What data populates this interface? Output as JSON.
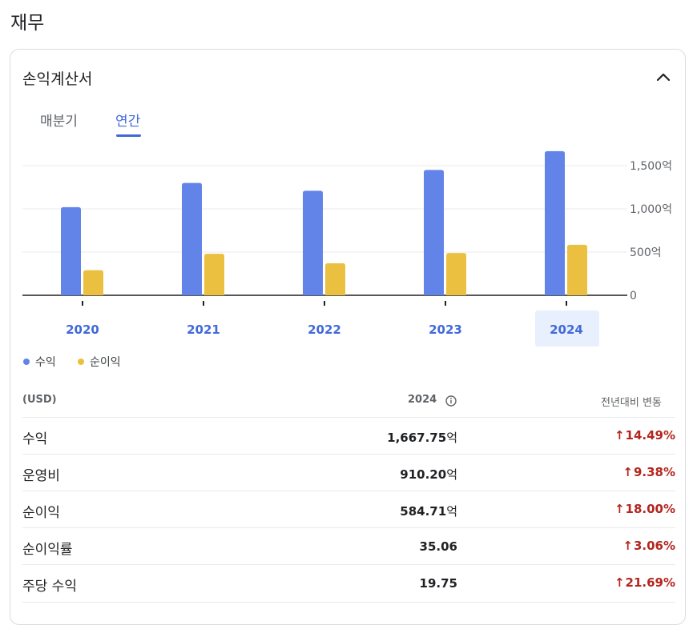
{
  "page_title": "재무",
  "card": {
    "title": "손익계산서",
    "tabs": [
      {
        "label": "매분기",
        "selected": false
      },
      {
        "label": "연간",
        "selected": true
      }
    ]
  },
  "colors": {
    "revenue": "#6284e8",
    "net_income": "#ebc040",
    "accent": "#4169d9",
    "up": "#b3261e"
  },
  "chart_data": {
    "type": "bar",
    "categories": [
      "2020",
      "2021",
      "2022",
      "2023",
      "2024"
    ],
    "selected_category": "2024",
    "series": [
      {
        "name": "수익",
        "values": [
          1020,
          1300,
          1210,
          1450,
          1667.75
        ]
      },
      {
        "name": "순이익",
        "values": [
          290,
          480,
          370,
          490,
          584.71
        ]
      }
    ],
    "ylim": [
      0,
      1500
    ],
    "yticks": [
      {
        "value": 0,
        "label": "0"
      },
      {
        "value": 500,
        "label": "500억"
      },
      {
        "value": 1000,
        "label": "1,000억"
      },
      {
        "value": 1500,
        "label": "1,500억"
      }
    ],
    "grid": true
  },
  "table": {
    "currency": "(USD)",
    "year": "2024",
    "change_header": "전년대비 변동",
    "rows": [
      {
        "label": "수익",
        "value": "1,667.75",
        "unit": "억",
        "change": "14.49%"
      },
      {
        "label": "운영비",
        "value": "910.20",
        "unit": "억",
        "change": "9.38%"
      },
      {
        "label": "순이익",
        "value": "584.71",
        "unit": "억",
        "change": "18.00%"
      },
      {
        "label": "순이익률",
        "value": "35.06",
        "unit": "",
        "change": "3.06%"
      },
      {
        "label": "주당 수익",
        "value": "19.75",
        "unit": "",
        "change": "21.69%"
      }
    ]
  }
}
